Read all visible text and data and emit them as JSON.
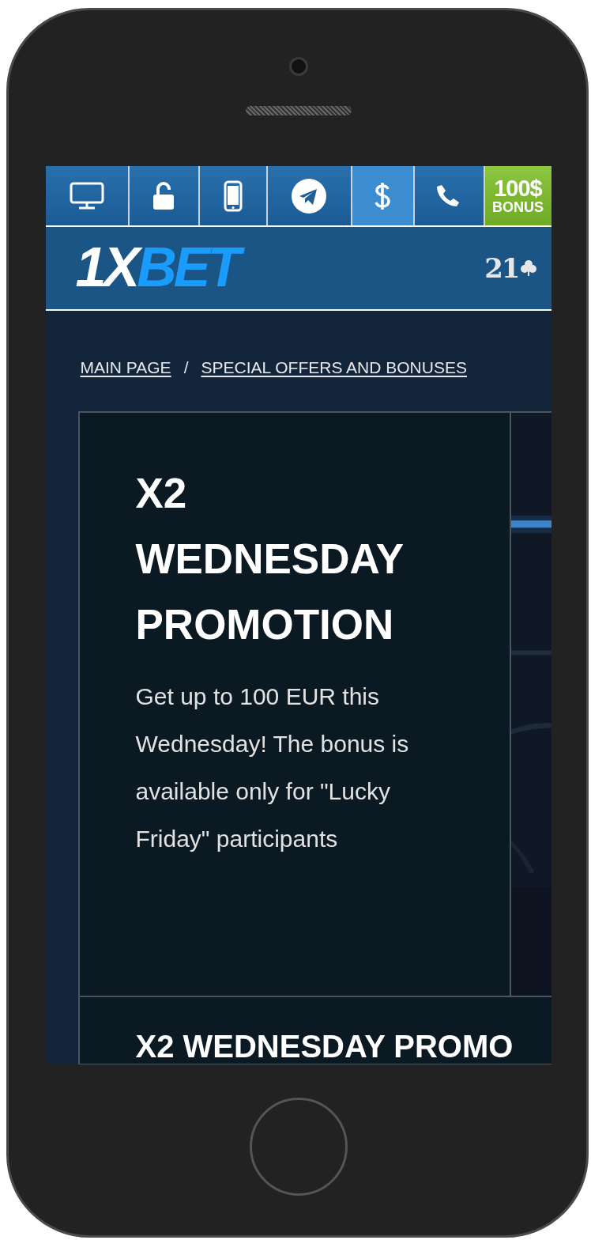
{
  "top_bar": {
    "items": [
      {
        "selected": false
      },
      {
        "selected": false
      },
      {
        "selected": false
      },
      {
        "selected": false
      },
      {
        "selected": true
      },
      {
        "selected": false
      }
    ],
    "bonus": {
      "amount": "100$",
      "label": "BONUS"
    }
  },
  "header": {
    "logo": {
      "text": "1X",
      "accent": "BET"
    },
    "age_badge": "21"
  },
  "breadcrumbs": [
    {
      "label": "MAIN PAGE"
    },
    {
      "label": "SPECIAL OFFERS AND BONUSES"
    }
  ],
  "breadcrumb_separator": "/",
  "promos": [
    {
      "title": "X2 WEDNESDAY PROMOTION",
      "description": "Get up to 100 EUR this Wednesday! The bonus is available only for \"Lucky Friday\" participants",
      "kind": "picture"
    },
    {
      "title": "X2 WEDNESDAY PROMO"
    }
  ]
}
